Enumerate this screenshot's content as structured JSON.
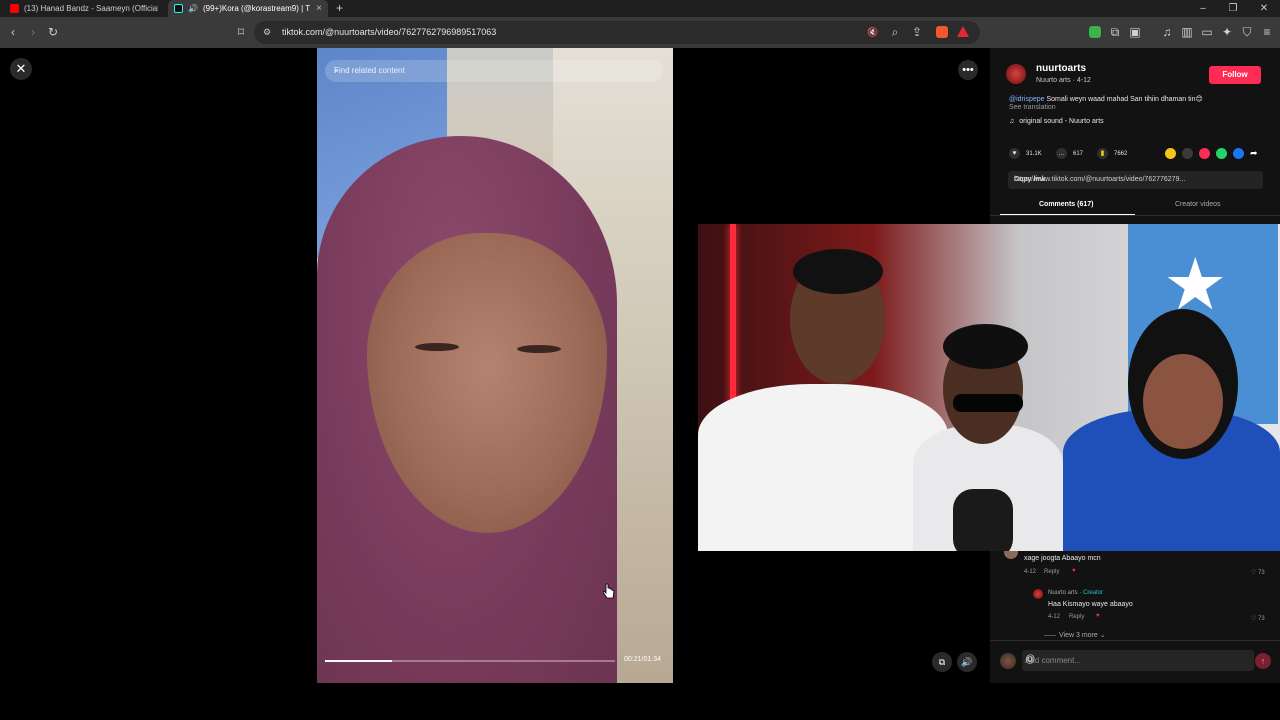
{
  "browser": {
    "tabs": [
      {
        "label": "(13) Hanad Bandz - Saameyn (Official"
      },
      {
        "label": "(99+)Kora (@korastream9) | T"
      }
    ],
    "url": "tiktok.com/@nuurtoarts/video/7627762796989517063",
    "new_tab": "+"
  },
  "video": {
    "search_placeholder": "Find related content",
    "time": "00:21/01:34",
    "progress_fraction": 0.23
  },
  "post": {
    "username": "nuurtoarts",
    "subtitle": "Nuurto arts · 4-12",
    "follow_label": "Follow",
    "caption_mention": "@idrispepe",
    "caption_text": " Somali weyn waad mahad San tihiin dhaman tin😊",
    "see_translation": "See translation",
    "sound": "original sound - Nuurto arts",
    "likes": "31.1K",
    "comments": "617",
    "saves": "7662",
    "link": "https://www.tiktok.com/@nuurtoarts/video/762776279...",
    "copy_link": "Copy link",
    "tab_comments": "Comments (617)",
    "tab_creator": "Creator videos"
  },
  "comments": [
    {
      "text": "xage joogta Abaayo mcn",
      "date": "4-12",
      "reply": "Reply",
      "likes": "73"
    },
    {
      "author": "Nuurto arts",
      "tag": "Creator",
      "text": "Haa Kismayo waye abaayo",
      "date": "4-12",
      "reply": "Reply",
      "likes": "73"
    }
  ],
  "view_more": "View 3 more",
  "comment_placeholder": "Add comment...",
  "colors": {
    "accent": "#fe2c55",
    "creator": "#25c0d8"
  }
}
